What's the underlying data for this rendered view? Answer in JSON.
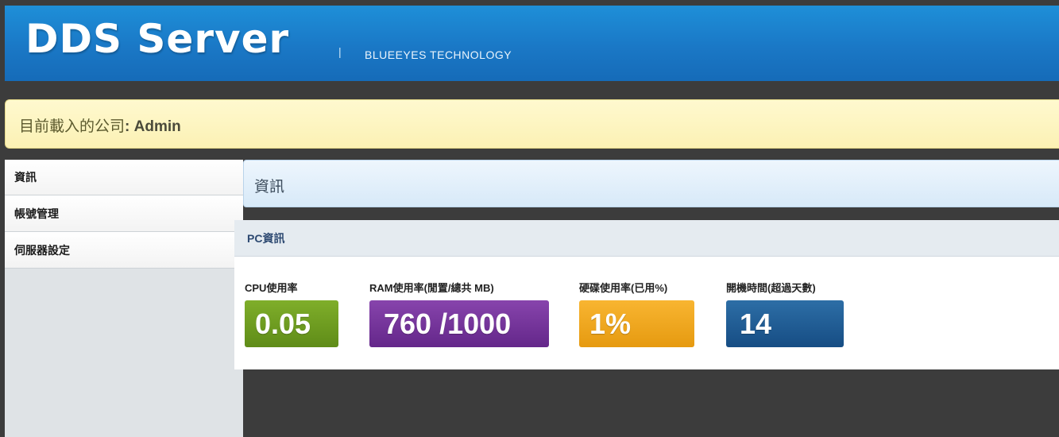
{
  "header": {
    "logo": "DDS Server",
    "separator": "|",
    "tagline": "BLUEEYES TECHNOLOGY"
  },
  "company": {
    "label": "目前載入的公司",
    "colon": ":",
    "name": "Admin"
  },
  "sidebar": {
    "items": [
      {
        "label": "資訊"
      },
      {
        "label": "帳號管理"
      },
      {
        "label": "伺服器設定"
      }
    ]
  },
  "page": {
    "title": "資訊"
  },
  "panel": {
    "title": "PC資訊",
    "stats": [
      {
        "label": "CPU使用率",
        "value": "0.05",
        "color": "#6f9e22"
      },
      {
        "label": "RAM使用率(閒置/總共 MB)",
        "value": "760 /1000",
        "color": "#7a37a0"
      },
      {
        "label": "硬碟使用率(已用%)",
        "value": "1%",
        "color": "#f0a820"
      },
      {
        "label": "開機時間(超過天數)",
        "value": "14",
        "color": "#215f96"
      }
    ]
  }
}
